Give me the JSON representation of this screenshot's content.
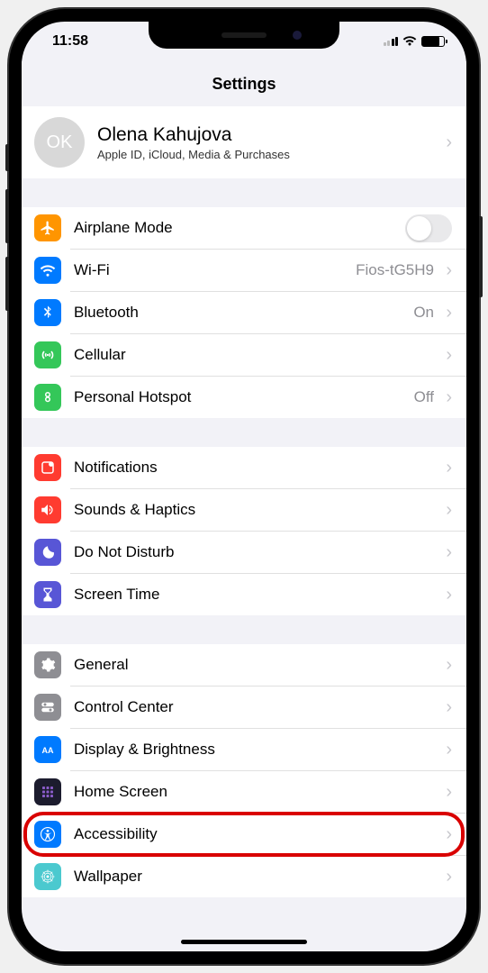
{
  "status": {
    "time": "11:58"
  },
  "header": {
    "title": "Settings"
  },
  "profile": {
    "initials": "OK",
    "name": "Olena Kahujova",
    "subtitle": "Apple ID, iCloud, Media & Purchases"
  },
  "groups": [
    {
      "items": [
        {
          "icon": "airplane-icon",
          "color": "bg-orange",
          "label": "Airplane Mode",
          "control": "toggle"
        },
        {
          "icon": "wifi-icon",
          "color": "bg-blue",
          "label": "Wi-Fi",
          "value": "Fios-tG5H9",
          "control": "link"
        },
        {
          "icon": "bluetooth-icon",
          "color": "bg-blue",
          "label": "Bluetooth",
          "value": "On",
          "control": "link"
        },
        {
          "icon": "cellular-icon",
          "color": "bg-green",
          "label": "Cellular",
          "control": "link"
        },
        {
          "icon": "hotspot-icon",
          "color": "bg-green",
          "label": "Personal Hotspot",
          "value": "Off",
          "control": "link"
        }
      ]
    },
    {
      "items": [
        {
          "icon": "notifications-icon",
          "color": "bg-red",
          "label": "Notifications",
          "control": "link"
        },
        {
          "icon": "sounds-icon",
          "color": "bg-red",
          "label": "Sounds & Haptics",
          "control": "link"
        },
        {
          "icon": "moon-icon",
          "color": "bg-purple",
          "label": "Do Not Disturb",
          "control": "link"
        },
        {
          "icon": "hourglass-icon",
          "color": "bg-purple",
          "label": "Screen Time",
          "control": "link"
        }
      ]
    },
    {
      "items": [
        {
          "icon": "gear-icon",
          "color": "bg-gray",
          "label": "General",
          "control": "link"
        },
        {
          "icon": "control-center-icon",
          "color": "bg-gray",
          "label": "Control Center",
          "control": "link"
        },
        {
          "icon": "display-icon",
          "color": "bg-blue",
          "label": "Display & Brightness",
          "control": "link"
        },
        {
          "icon": "home-screen-icon",
          "color": "bg-navy",
          "label": "Home Screen",
          "control": "link"
        },
        {
          "icon": "accessibility-icon",
          "color": "bg-blue",
          "label": "Accessibility",
          "control": "link",
          "highlight": true
        },
        {
          "icon": "wallpaper-icon",
          "color": "bg-teal",
          "label": "Wallpaper",
          "control": "link"
        }
      ]
    }
  ]
}
